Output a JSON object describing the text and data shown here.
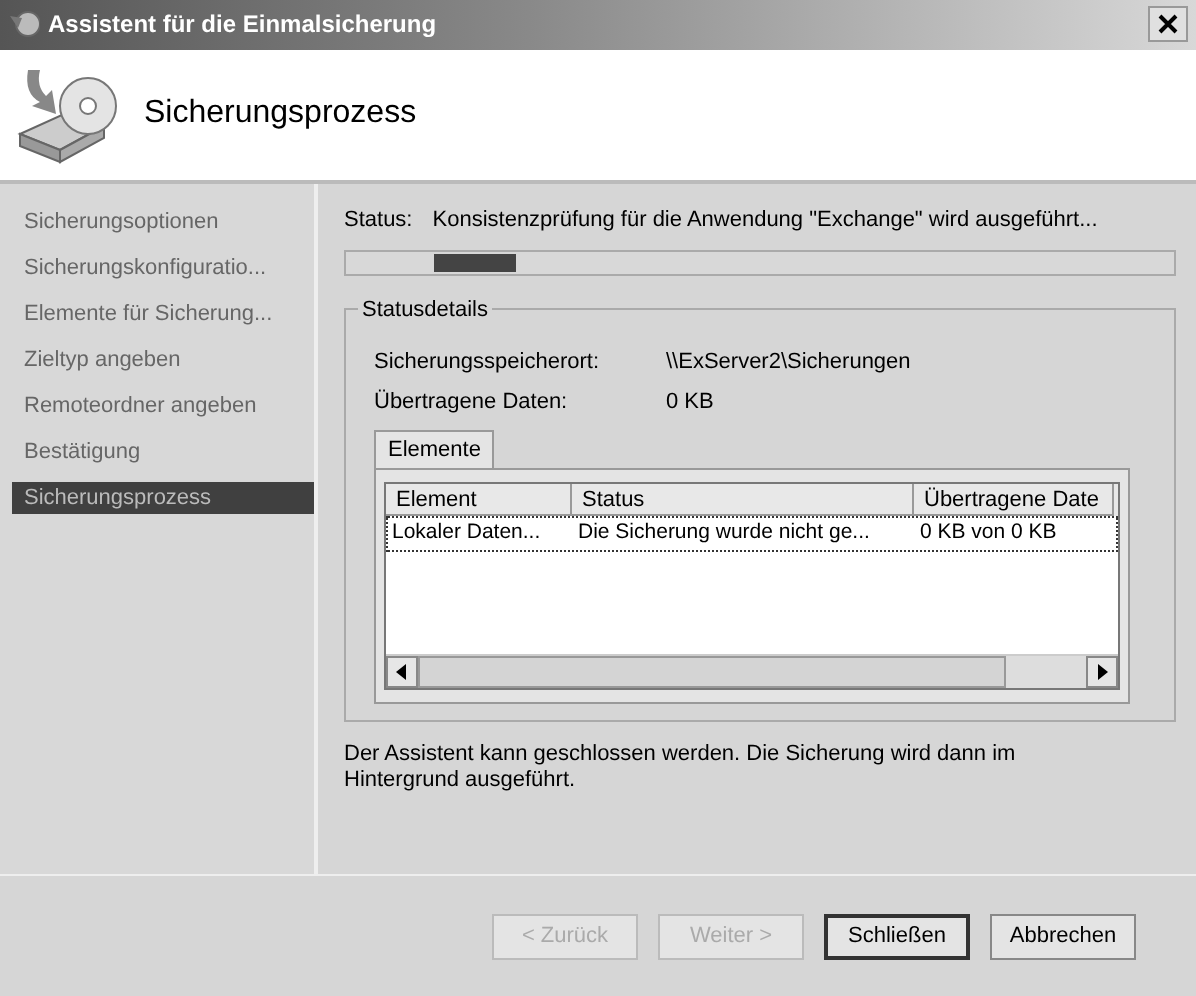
{
  "window": {
    "title": "Assistent für die Einmalsicherung"
  },
  "header": {
    "title": "Sicherungsprozess"
  },
  "sidebar": {
    "items": [
      {
        "label": "Sicherungsoptionen",
        "selected": false
      },
      {
        "label": "Sicherungskonfiguratio...",
        "selected": false
      },
      {
        "label": "Elemente für Sicherung...",
        "selected": false
      },
      {
        "label": "Zieltyp angeben",
        "selected": false
      },
      {
        "label": "Remoteordner angeben",
        "selected": false
      },
      {
        "label": "Bestätigung",
        "selected": false
      },
      {
        "label": "Sicherungsprozess",
        "selected": true
      }
    ]
  },
  "status": {
    "label": "Status:",
    "text": "Konsistenzprüfung für die Anwendung \"Exchange\" wird ausgeführt..."
  },
  "progress": {
    "level": 0.1
  },
  "details": {
    "title": "Statusdetails",
    "fields": [
      {
        "label": "Sicherungsspeicherort:",
        "value": "\\\\ExServer2\\Sicherungen"
      },
      {
        "label": "Übertragene Daten:",
        "value": "0 KB"
      }
    ],
    "tabs": [
      {
        "label": "Elemente",
        "selected": true
      }
    ],
    "table": {
      "columns": [
        "Element",
        "Status",
        "Übertragene Date"
      ],
      "rows": [
        {
          "cells": [
            "Lokaler Daten...",
            "Die Sicherung wurde nicht ge...",
            "0 KB von 0 KB"
          ],
          "selected": true
        }
      ]
    }
  },
  "message": "Der Assistent kann geschlossen werden. Die Sicherung wird dann im Hintergrund ausgeführt.",
  "buttons": [
    {
      "label": "< Zurück",
      "disabled": true,
      "default": false
    },
    {
      "label": "Weiter >",
      "disabled": true,
      "default": false
    },
    {
      "label": "Schließen",
      "disabled": false,
      "default": true
    },
    {
      "label": "Abbrechen",
      "disabled": false,
      "default": false
    }
  ]
}
